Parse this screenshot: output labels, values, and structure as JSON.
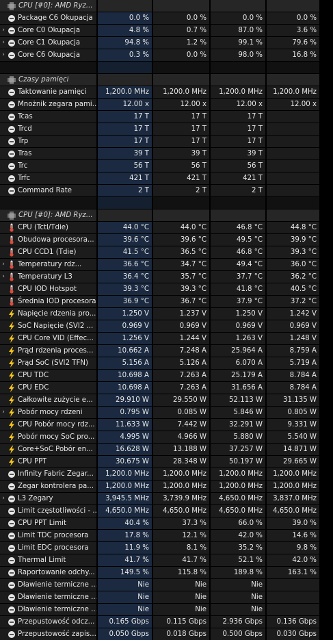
{
  "rows": [
    {
      "type": "header",
      "label": "CPU [#0]: AMD Ryz...",
      "icon": "chip-icon",
      "values": [
        "",
        "",
        "",
        ""
      ]
    },
    {
      "type": "item",
      "label": "Package C6 Okupacja",
      "icon": "clock-icon",
      "values": [
        "0.0 %",
        "0.0 %",
        "0.0 %",
        "0.0 %"
      ]
    },
    {
      "type": "item",
      "label": "Core C0 Okupacja",
      "icon": "clock-icon",
      "expand": true,
      "values": [
        "4.8 %",
        "0.7 %",
        "87.0 %",
        "3.6 %"
      ]
    },
    {
      "type": "item",
      "label": "Core C1 Okupacja",
      "icon": "clock-icon",
      "expand": true,
      "values": [
        "94.8 %",
        "1.2 %",
        "99.1 %",
        "79.6 %"
      ]
    },
    {
      "type": "item",
      "label": "Core C6 Okupacja",
      "icon": "clock-icon",
      "expand": true,
      "values": [
        "0.3 %",
        "0.0 %",
        "98.0 %",
        "16.8 %"
      ]
    },
    {
      "type": "blank",
      "values": [
        "",
        "",
        "",
        ""
      ]
    },
    {
      "type": "header",
      "label": "Czasy pamięci",
      "icon": "chip-icon",
      "values": [
        "",
        "",
        "",
        ""
      ]
    },
    {
      "type": "item",
      "label": "Taktowanie pamięci",
      "icon": "clock-icon",
      "values": [
        "1,200.0 MHz",
        "1,200.0 MHz",
        "1,200.0 MHz",
        "1,200.0 MHz"
      ]
    },
    {
      "type": "item",
      "label": "Mnożnik zegara pami...",
      "icon": "clock-icon",
      "values": [
        "12.00 x",
        "12.00 x",
        "12.00 x",
        "12.00 x"
      ]
    },
    {
      "type": "item",
      "label": "Tcas",
      "icon": "clock-icon",
      "values": [
        "17 T",
        "17 T",
        "17 T",
        ""
      ]
    },
    {
      "type": "item",
      "label": "Trcd",
      "icon": "clock-icon",
      "values": [
        "17 T",
        "17 T",
        "17 T",
        ""
      ]
    },
    {
      "type": "item",
      "label": "Trp",
      "icon": "clock-icon",
      "values": [
        "17 T",
        "17 T",
        "17 T",
        ""
      ]
    },
    {
      "type": "item",
      "label": "Tras",
      "icon": "clock-icon",
      "values": [
        "39 T",
        "39 T",
        "39 T",
        ""
      ]
    },
    {
      "type": "item",
      "label": "Trc",
      "icon": "clock-icon",
      "values": [
        "56 T",
        "56 T",
        "56 T",
        ""
      ]
    },
    {
      "type": "item",
      "label": "Trfc",
      "icon": "clock-icon",
      "values": [
        "421 T",
        "421 T",
        "421 T",
        ""
      ]
    },
    {
      "type": "item",
      "label": "Command Rate",
      "icon": "clock-icon",
      "values": [
        "2 T",
        "2 T",
        "2 T",
        ""
      ]
    },
    {
      "type": "blank",
      "values": [
        "",
        "",
        "",
        ""
      ]
    },
    {
      "type": "header",
      "label": "CPU [#0]: AMD Ryz...",
      "icon": "chip-icon",
      "values": [
        "",
        "",
        "",
        ""
      ]
    },
    {
      "type": "item",
      "label": "CPU (Tctl/Tdie)",
      "icon": "thermometer-icon",
      "values": [
        "44.0 °C",
        "44.0 °C",
        "46.8 °C",
        "44.8 °C"
      ]
    },
    {
      "type": "item",
      "label": "Obudowa procesora...",
      "icon": "thermometer-icon",
      "values": [
        "39.6 °C",
        "39.6 °C",
        "49.5 °C",
        "39.9 °C"
      ]
    },
    {
      "type": "item",
      "label": "CPU CCD1 (Tdie)",
      "icon": "thermometer-icon",
      "values": [
        "41.5 °C",
        "36.5 °C",
        "46.8 °C",
        "39.3 °C"
      ]
    },
    {
      "type": "item",
      "label": "Temperatury rdz...",
      "icon": "thermometer-icon",
      "expand": true,
      "values": [
        "36.6 °C",
        "34.7 °C",
        "49.4 °C",
        "36.0 °C"
      ]
    },
    {
      "type": "item",
      "label": "Temperatury L3",
      "icon": "thermometer-icon",
      "expand": true,
      "values": [
        "36.4 °C",
        "35.7 °C",
        "37.7 °C",
        "36.2 °C"
      ]
    },
    {
      "type": "item",
      "label": "CPU IOD Hotspot",
      "icon": "thermometer-icon",
      "values": [
        "39.3 °C",
        "39.3 °C",
        "41.8 °C",
        "40.5 °C"
      ]
    },
    {
      "type": "item",
      "label": "Średnia IOD procesora",
      "icon": "thermometer-icon",
      "values": [
        "36.9 °C",
        "36.7 °C",
        "37.9 °C",
        "37.2 °C"
      ]
    },
    {
      "type": "item",
      "label": "Napięcie rdzenia pro...",
      "icon": "bolt-icon",
      "values": [
        "1.250 V",
        "1.237 V",
        "1.250 V",
        "1.242 V"
      ]
    },
    {
      "type": "item",
      "label": "SoC Napięcie (SVI2 ...",
      "icon": "bolt-icon",
      "values": [
        "0.969 V",
        "0.969 V",
        "0.969 V",
        "0.969 V"
      ]
    },
    {
      "type": "item",
      "label": "CPU Core VID (Effec...",
      "icon": "bolt-icon",
      "values": [
        "1.256 V",
        "1.244 V",
        "1.263 V",
        "1.248 V"
      ]
    },
    {
      "type": "item",
      "label": "Prąd rdzenia proces...",
      "icon": "bolt-icon",
      "values": [
        "10.662 A",
        "7.248 A",
        "25.964 A",
        "8.759 A"
      ]
    },
    {
      "type": "item",
      "label": "Prąd SoC (SVI2 TFN)",
      "icon": "bolt-icon",
      "values": [
        "5.156 A",
        "5.126 A",
        "6.070 A",
        "5.719 A"
      ]
    },
    {
      "type": "item",
      "label": "CPU TDC",
      "icon": "bolt-icon",
      "values": [
        "10.698 A",
        "7.263 A",
        "25.179 A",
        "8.784 A"
      ]
    },
    {
      "type": "item",
      "label": "CPU EDC",
      "icon": "bolt-icon",
      "values": [
        "10.698 A",
        "7.263 A",
        "31.656 A",
        "8.784 A"
      ]
    },
    {
      "type": "item",
      "label": "Całkowite zużycie e...",
      "icon": "bolt-icon",
      "values": [
        "29.910 W",
        "29.550 W",
        "52.113 W",
        "31.135 W"
      ]
    },
    {
      "type": "item",
      "label": "Pobór mocy rdzeni",
      "icon": "bolt-icon",
      "expand": true,
      "values": [
        "0.795 W",
        "0.085 W",
        "5.846 W",
        "0.805 W"
      ]
    },
    {
      "type": "item",
      "label": "CPU Pobór mocy rdz...",
      "icon": "bolt-icon",
      "values": [
        "11.633 W",
        "7.442 W",
        "32.291 W",
        "9.331 W"
      ]
    },
    {
      "type": "item",
      "label": "Pobór mocy SoC pro...",
      "icon": "bolt-icon",
      "values": [
        "4.995 W",
        "4.966 W",
        "5.880 W",
        "5.540 W"
      ]
    },
    {
      "type": "item",
      "label": "Core+SoC Pobór en...",
      "icon": "bolt-icon",
      "values": [
        "16.628 W",
        "13.188 W",
        "37.257 W",
        "14.871 W"
      ]
    },
    {
      "type": "item",
      "label": "CPU PPT",
      "icon": "bolt-icon",
      "values": [
        "30.675 W",
        "28.348 W",
        "50.197 W",
        "29.665 W"
      ]
    },
    {
      "type": "item",
      "label": "Infinity Fabric Zegar...",
      "icon": "clock-icon",
      "values": [
        "1,200.0 MHz",
        "1,200.0 MHz",
        "1,200.0 MHz",
        "1,200.0 MHz"
      ]
    },
    {
      "type": "item",
      "label": "Zegar kontrolera pa...",
      "icon": "clock-icon",
      "values": [
        "1,200.0 MHz",
        "1,200.0 MHz",
        "1,200.0 MHz",
        "1,200.0 MHz"
      ]
    },
    {
      "type": "item",
      "label": "L3 Zegary",
      "icon": "clock-icon",
      "expand": true,
      "values": [
        "3,945.5 MHz",
        "3,739.9 MHz",
        "4,650.0 MHz",
        "3,837.0 MHz"
      ]
    },
    {
      "type": "item",
      "label": "Limit częstotliwości - ...",
      "icon": "clock-icon",
      "values": [
        "4,650.0 MHz",
        "4,650.0 MHz",
        "4,650.0 MHz",
        "4,650.0 MHz"
      ]
    },
    {
      "type": "item",
      "label": "CPU PPT Limit",
      "icon": "clock-icon",
      "values": [
        "40.4 %",
        "37.3 %",
        "66.0 %",
        "39.0 %"
      ]
    },
    {
      "type": "item",
      "label": "Limit TDC procesora",
      "icon": "clock-icon",
      "values": [
        "17.8 %",
        "12.1 %",
        "42.0 %",
        "14.6 %"
      ]
    },
    {
      "type": "item",
      "label": "Limit EDC procesora",
      "icon": "clock-icon",
      "values": [
        "11.9 %",
        "8.1 %",
        "35.2 %",
        "9.8 %"
      ]
    },
    {
      "type": "item",
      "label": "Thermal Limit",
      "icon": "clock-icon",
      "values": [
        "41.7 %",
        "41.7 %",
        "52.1 %",
        "42.0 %"
      ]
    },
    {
      "type": "item",
      "label": "Raportowanie odchy...",
      "icon": "clock-icon",
      "values": [
        "149.5 %",
        "115.8 %",
        "189.8 %",
        "163.1 %"
      ]
    },
    {
      "type": "item",
      "label": "Dławienie termiczne ...",
      "icon": "clock-icon",
      "values": [
        "Nie",
        "Nie",
        "Nie",
        ""
      ]
    },
    {
      "type": "item",
      "label": "Dławienie termiczne ...",
      "icon": "clock-icon",
      "values": [
        "Nie",
        "Nie",
        "Nie",
        ""
      ]
    },
    {
      "type": "item",
      "label": "Dławienie termiczne ...",
      "icon": "clock-icon",
      "values": [
        "Nie",
        "Nie",
        "Nie",
        ""
      ]
    },
    {
      "type": "item",
      "label": "Przepustowość odcz...",
      "icon": "clock-icon",
      "values": [
        "0.165 Gbps",
        "0.115 Gbps",
        "2.936 Gbps",
        "0.136 Gbps"
      ]
    },
    {
      "type": "item",
      "label": "Przepustowość zapis...",
      "icon": "clock-icon",
      "values": [
        "0.050 Gbps",
        "0.018 Gbps",
        "0.500 Gbps",
        "0.030 Gbps"
      ]
    }
  ],
  "colors": {
    "background": "#000000",
    "cell": "#1c1c1c",
    "current_column": "#1b2a40",
    "bolt": "#f5c518",
    "thermometer": "#e04a3a"
  }
}
